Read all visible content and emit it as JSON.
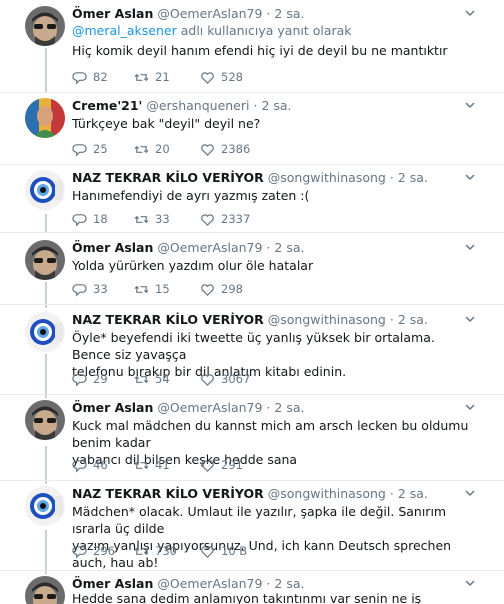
{
  "tweets": [
    {
      "name": "Ömer Aslan",
      "handle": "@OemerAslan79",
      "dot": "·",
      "time": "2 sa.",
      "reply_mention": "@meral_aksener",
      "reply_suffix": " adlı kullanıcıya yanıt olarak",
      "text": "Hiç komik deyil hanım efendi hiç iyi de deyil bu ne mantıktır",
      "replies": "82",
      "retweets": "21",
      "likes": "528",
      "avatar": "sunglasses-man-avatar"
    },
    {
      "name": "Creme'21'",
      "handle": "@ershanqueneri",
      "dot": "·",
      "time": "2 sa.",
      "text": "Türkçeye bak \"deyil\" deyil ne?",
      "replies": "25",
      "retweets": "20",
      "likes": "2386",
      "avatar": "colorful-portrait-avatar"
    },
    {
      "name": "NAZ TEKRAR KİLO VERİYOR",
      "handle": "@songwithinasong",
      "dot": "·",
      "time": "2 sa.",
      "text": "Hanımefendiyi de ayrı yazmış zaten :(",
      "replies": "18",
      "retweets": "33",
      "likes": "2337",
      "avatar": "evil-eye-avatar"
    },
    {
      "name": "Ömer Aslan",
      "handle": "@OemerAslan79",
      "dot": "·",
      "time": "2 sa.",
      "text": "Yolda yürürken yazdım olur öle hatalar",
      "replies": "33",
      "retweets": "15",
      "likes": "298",
      "avatar": "sunglasses-man-avatar"
    },
    {
      "name": "NAZ TEKRAR KİLO VERİYOR",
      "handle": "@songwithinasong",
      "dot": "·",
      "time": "2 sa.",
      "text_lines": [
        "Öyle* beyefendi iki tweette üç yanlış yüksek bir ortalama. Bence siz yavaşça",
        "telefonu bırakıp bir dil anlatım kitabı edinin."
      ],
      "replies": "29",
      "retweets": "54",
      "likes": "3067",
      "avatar": "evil-eye-avatar"
    },
    {
      "name": "Ömer Aslan",
      "handle": "@OemerAslan79",
      "dot": "·",
      "time": "2 sa.",
      "text_lines": [
        "Kuck mal mädchen du kannst mich am arsch lecken bu oldumu benim kadar",
        "yabancı dil bilsen keşke hedde sana"
      ],
      "replies": "46",
      "retweets": "41",
      "likes": "291",
      "avatar": "sunglasses-man-avatar"
    },
    {
      "name": "NAZ TEKRAR KİLO VERİYOR",
      "handle": "@songwithinasong",
      "dot": "·",
      "time": "2 sa.",
      "text_lines": [
        "Mädchen* olacak. Umlaut ile yazılır, şapka ile değil. Sanırım ısrarla üç dilde",
        "yazım yanlışı yapıyorsunuz. Und, ich kann Deutsch sprechen auch, hau ab!"
      ],
      "replies": "296",
      "retweets": "730",
      "likes": "10 B",
      "avatar": "evil-eye-avatar"
    },
    {
      "name": "Ömer Aslan",
      "handle": "@OemerAslan79",
      "dot": "·",
      "time": "2 sa.",
      "text": "Hedde sana dedim anlamıyon takıntınmı var senin ne iş",
      "avatar": "sunglasses-man-avatar"
    }
  ],
  "colors": {
    "text": "#14171a",
    "muted": "#657786",
    "link": "#1b95e0",
    "thread_line": "#c4cfd6"
  },
  "icons": {
    "reply": "reply-icon",
    "retweet": "retweet-icon",
    "like": "heart-icon",
    "menu": "chevron-down-icon"
  }
}
